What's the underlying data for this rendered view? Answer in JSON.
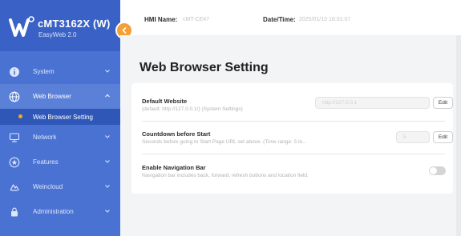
{
  "brand": {
    "title": "cMT3162X (W)",
    "subtitle": "EasyWeb 2.0"
  },
  "header": {
    "hmi_name_label": "HMI Name:",
    "hmi_name_value": "cMT-CE47",
    "datetime_label": "Date/Time:",
    "datetime_value": "2025/01/13 16:01:07"
  },
  "sidebar": {
    "items": [
      {
        "label": "System",
        "icon": "info-icon"
      },
      {
        "label": "Web Browser",
        "icon": "globe-icon",
        "expanded": true,
        "children": [
          {
            "label": "Web Browser Setting",
            "active": true
          }
        ]
      },
      {
        "label": "Network",
        "icon": "network-icon"
      },
      {
        "label": "Features",
        "icon": "features-icon"
      },
      {
        "label": "Weincloud",
        "icon": "cloud-icon"
      },
      {
        "label": "Administration",
        "icon": "lock-icon"
      }
    ]
  },
  "main": {
    "title": "Web Browser Setting",
    "settings": [
      {
        "title": "Default Website",
        "description": "(default: http://127.0.0.1/) (System Settings)",
        "value": "http://127.0.0.1",
        "button": "Edit"
      },
      {
        "title": "Countdown before Start",
        "description": "Seconds before going to Start Page URL set above. (Time range: 5 to...",
        "value": "5",
        "button": "Edit"
      },
      {
        "title": "Enable Navigation Bar",
        "description": "Navigation bar includes back, forward, refresh buttons and location field.",
        "enabled": false
      }
    ]
  },
  "colors": {
    "sidebar": "#4a72d2",
    "accent": "#f5a036",
    "active_dot": "#f5a623"
  }
}
